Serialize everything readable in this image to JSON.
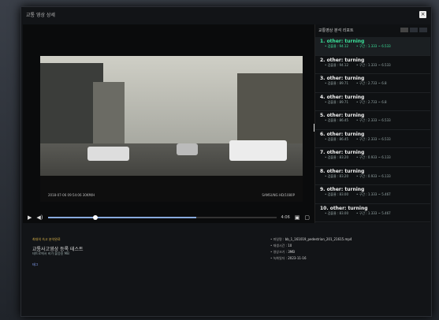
{
  "window": {
    "title": "교통 영상 상세",
    "close_label": "×"
  },
  "panel": {
    "title": "교통영상 분석 리포트",
    "toggle_labels": [
      "",
      "",
      ""
    ],
    "items": [
      {
        "rank": "1.",
        "label": "other: turning",
        "score": "• 검출율 : 94.12",
        "range": "• 구간 : 1.333 ~ 6.533"
      },
      {
        "rank": "2.",
        "label": "other: turning",
        "score": "• 검출율 : 94.12",
        "range": "• 구간 : 1.333 ~ 6.533"
      },
      {
        "rank": "3.",
        "label": "other: turning",
        "score": "• 검출율 : 89.71",
        "range": "• 구간 : 2.733 ~ 6.8"
      },
      {
        "rank": "4.",
        "label": "other: turning",
        "score": "• 검출율 : 89.71",
        "range": "• 구간 : 2.733 ~ 6.8"
      },
      {
        "rank": "5.",
        "label": "other: turning",
        "score": "• 검출율 : 86.45",
        "range": "• 구간 : 2.333 ~ 6.533"
      },
      {
        "rank": "6.",
        "label": "other: turning",
        "score": "• 검출율 : 86.45",
        "range": "• 구간 : 2.333 ~ 6.533"
      },
      {
        "rank": "7.",
        "label": "other: turning",
        "score": "• 검출율 : 83.20",
        "range": "• 구간 : 0.933 ~ 6.133"
      },
      {
        "rank": "8.",
        "label": "other: turning",
        "score": "• 검출율 : 83.20",
        "range": "• 구간 : 0.933 ~ 6.133"
      },
      {
        "rank": "9.",
        "label": "other: turning",
        "score": "• 검출율 : 83.00",
        "range": "• 구간 : 1.333 ~ 5.467"
      },
      {
        "rank": "10.",
        "label": "other: turning",
        "score": "• 검출율 : 83.00",
        "range": "• 구간 : 1.333 ~ 5.467"
      }
    ]
  },
  "video": {
    "timestamp": "2018-07-06 09:54:06 30KM/H",
    "resolution": "SAMSUNG HD/1080P",
    "time_label": "4:06",
    "progress": 0.65,
    "buffer": 0.55,
    "knob": 0.21
  },
  "info": {
    "badge": "최대의 속고 분석완료",
    "title": "교통사고영상 등록 테스트",
    "subtitle": "테트로에서 비가 불응용 MB",
    "tag": "태그",
    "props": [
      {
        "label": "• 파일명 : ",
        "value": "bb_1_161019_pedestrian_201_21615.mp4"
      },
      {
        "label": "• 재생시간 : ",
        "value": "10"
      },
      {
        "label": "• 영상크기 : ",
        "value": "3MB"
      },
      {
        "label": "• 녹화일자 : ",
        "value": "2023-11-16"
      }
    ]
  }
}
